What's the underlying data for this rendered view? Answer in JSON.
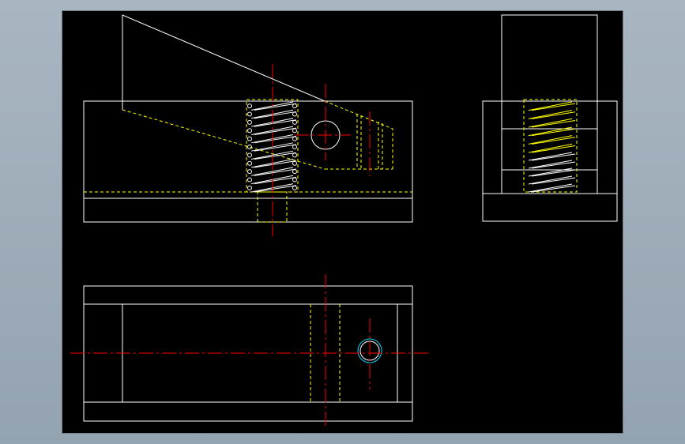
{
  "colors": {
    "background": "#000000",
    "window": "#a2b0bc",
    "outline": "#ffffff",
    "hidden": "#ffff00",
    "centerline": "#ff0000",
    "hole_outline": "#00d8ff"
  },
  "views": [
    "front-view",
    "side-view",
    "top-view"
  ]
}
